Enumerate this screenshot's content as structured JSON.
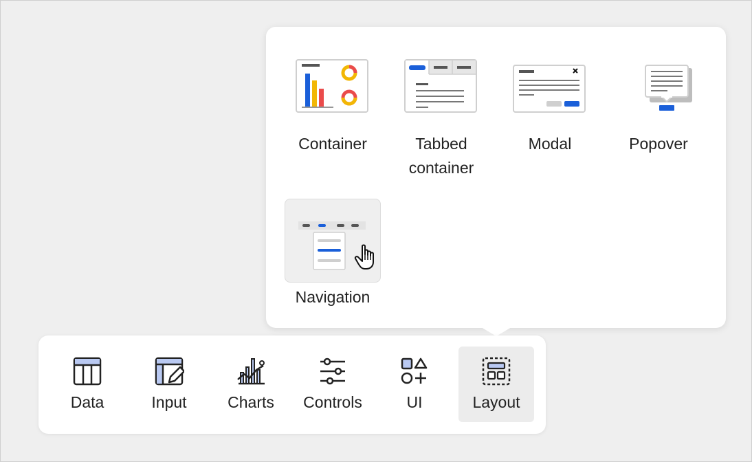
{
  "layout_popover": {
    "items": [
      {
        "label": "Container"
      },
      {
        "label": "Tabbed\ncontainer"
      },
      {
        "label": "Modal"
      },
      {
        "label": "Popover"
      },
      {
        "label": "Navigation"
      }
    ],
    "hovered": "Navigation"
  },
  "toolbar": {
    "items": [
      {
        "label": "Data",
        "icon": "table-icon"
      },
      {
        "label": "Input",
        "icon": "input-edit-icon"
      },
      {
        "label": "Charts",
        "icon": "charts-icon"
      },
      {
        "label": "Controls",
        "icon": "sliders-icon"
      },
      {
        "label": "UI",
        "icon": "shapes-icon"
      },
      {
        "label": "Layout",
        "icon": "layout-icon"
      }
    ],
    "active": "Layout"
  },
  "colors": {
    "accent_blue": "#1a5fd9",
    "bar_yellow": "#f2b705",
    "bar_red": "#ea4b4b",
    "hover_bg": "#efefef",
    "icon_dark": "#222222"
  }
}
